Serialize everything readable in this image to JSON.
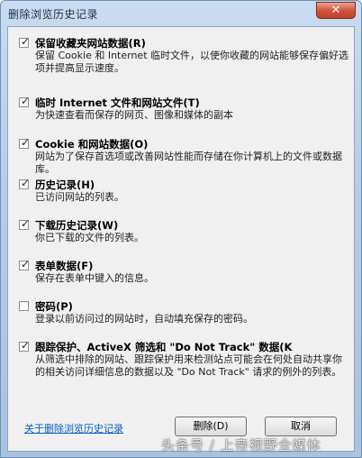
{
  "window": {
    "title": "删除浏览历史记录",
    "close_label": "✕"
  },
  "options": [
    {
      "checked": true,
      "title": "保留收藏夹网站数据(R)",
      "desc": "保留 Cookie 和 Internet 临时文件，以使你收藏的网站能够保存偏好选项并提高显示速度。"
    },
    {
      "checked": true,
      "title": "临时 Internet 文件和网站文件(T)",
      "desc": "为快速查看而保存的网页、图像和媒体的副本"
    },
    {
      "checked": true,
      "title": "Cookie 和网站数据(O)",
      "desc": "网站为了保存首选项或改善网站性能而存储在你计算机上的文件或数据库。"
    },
    {
      "checked": true,
      "title": "历史记录(H)",
      "desc": "已访问网站的列表。"
    },
    {
      "checked": true,
      "title": "下载历史记录(W)",
      "desc": "你已下载的文件的列表。"
    },
    {
      "checked": true,
      "title": "表单数据(F)",
      "desc": "保存在表单中键入的信息。"
    },
    {
      "checked": false,
      "title": "密码(P)",
      "desc": "登录以前访问过的网站时，自动填充保存的密码。"
    },
    {
      "checked": true,
      "title": "跟踪保护、ActiveX 筛选和 \"Do Not Track\" 数据(K",
      "desc": "从筛选中排除的网站、跟踪保护用来检测站点可能会在何处自动共享你的相关访问详细信息的数据以及 \"Do Not Track\" 请求的例外的列表。"
    }
  ],
  "footer": {
    "link": "关于删除浏览历史记录",
    "delete_label": "删除(D)",
    "cancel_label": "取消"
  },
  "watermark": "头条号 / 上帝视野全媒体"
}
